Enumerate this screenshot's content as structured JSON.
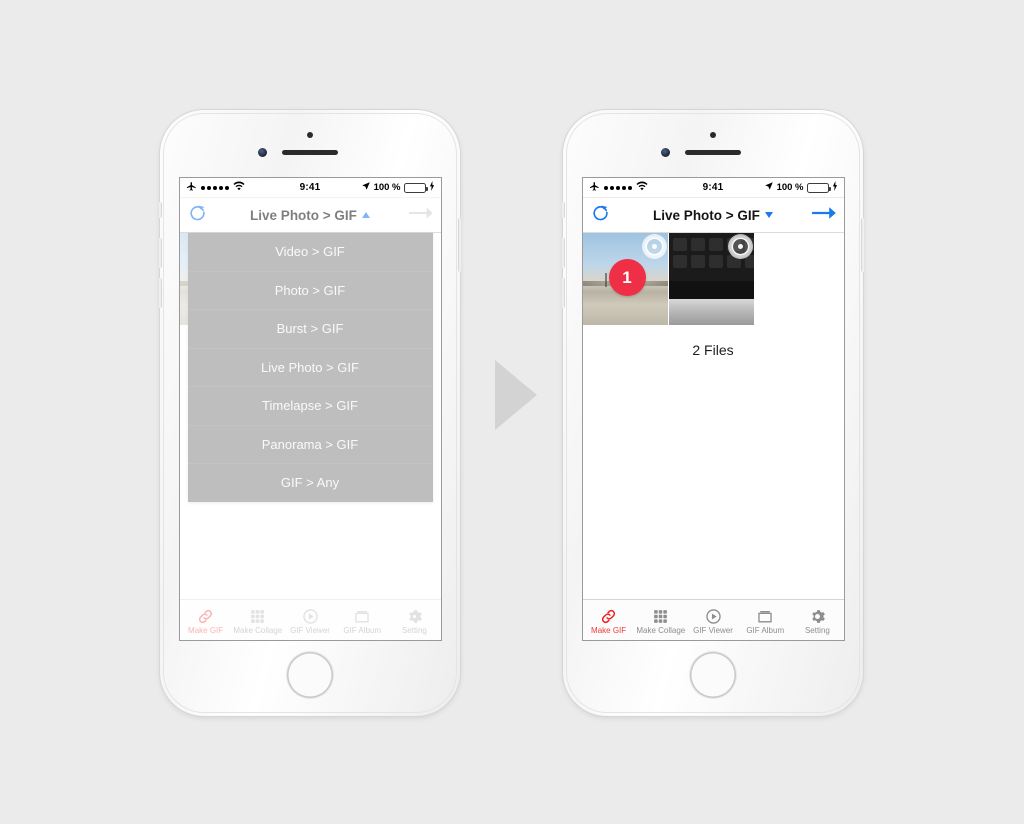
{
  "status_bar": {
    "airplane_icon": "airplane-icon",
    "signal_dots": 5,
    "wifi_icon": "wifi-icon",
    "time": "9:41",
    "location_icon": "location-arrow-icon",
    "battery_text": "100 %",
    "charging_icon": "lightning-bolt-icon"
  },
  "nav": {
    "refresh_icon": "refresh-icon",
    "title": "Live Photo > GIF",
    "chevron_up_icon": "chevron-up-icon",
    "chevron_down_icon": "chevron-down-icon",
    "forward_icon": "arrow-right-icon"
  },
  "colors": {
    "accent_blue": "#1b79f0",
    "accent_red": "#ef3b3b",
    "badge_red": "#ef2f45",
    "dropdown_bg": "#545454",
    "battery_green": "#4cd964",
    "page_bg": "#ebebeb",
    "arrow_gray": "#d3d3d3"
  },
  "dropdown": {
    "items": [
      {
        "label": "Video > GIF"
      },
      {
        "label": "Photo > GIF"
      },
      {
        "label": "Burst > GIF"
      },
      {
        "label": "Live Photo > GIF"
      },
      {
        "label": "Timelapse > GIF"
      },
      {
        "label": "Panorama > GIF"
      },
      {
        "label": "GIF > Any"
      }
    ]
  },
  "gallery": {
    "files_label": "2 Files",
    "thumbnails": [
      {
        "name": "landscape-thumbnail",
        "badge": "1",
        "live_icon": "live-photo-icon"
      },
      {
        "name": "keyboard-thumbnail",
        "badge": "",
        "live_icon": "live-photo-icon"
      }
    ]
  },
  "tabbar": {
    "items": [
      {
        "label": "Make GIF",
        "icon": "link-icon",
        "active": true
      },
      {
        "label": "Make Collage",
        "icon": "grid-icon",
        "active": false
      },
      {
        "label": "GIF Viewer",
        "icon": "play-circle-icon",
        "active": false
      },
      {
        "label": "GIF Album",
        "icon": "album-icon",
        "active": false
      },
      {
        "label": "Setting",
        "icon": "gear-icon",
        "active": false
      }
    ]
  },
  "transition": {
    "arrow_icon": "triangle-right-icon"
  }
}
